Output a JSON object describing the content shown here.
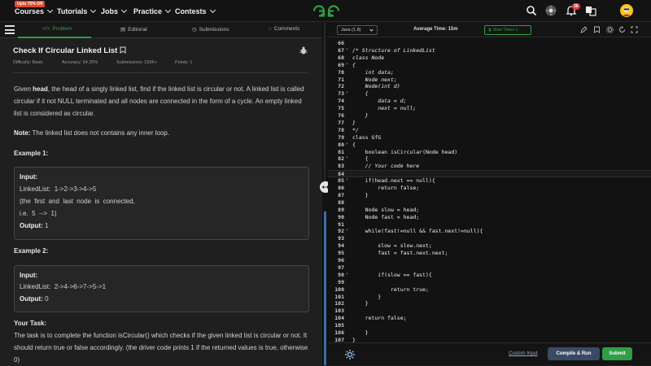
{
  "nav": {
    "promo": "Upto 75% Off",
    "items": [
      "Courses",
      "Tutorials",
      "Jobs",
      "Practice",
      "Contests"
    ],
    "notification_count": "38",
    "icons": [
      "search-icon",
      "theme-toggle-icon",
      "bell-icon",
      "translate-icon",
      "avatar"
    ]
  },
  "tabs": {
    "problem": "Problem",
    "editorial": "Editorial",
    "submissions": "Submissions",
    "comments": "Comments"
  },
  "problem": {
    "title": "Check If Circular Linked List",
    "difficulty": "Difficulty: Basic",
    "accuracy": "Accuracy: 54.26%",
    "submissions": "Submissions: 155K+",
    "points": "Points: 1",
    "desc_head": "head",
    "desc_pre": "Given ",
    "desc_post": ", the head of a singly linked list, find if the linked list is circular or not. A linked list is called circular if it not NULL terminated and all nodes are connected in the form of a cycle. An empty linked list is considered as circular.",
    "note_label": "Note:",
    "note_text": " The linked list does not contains any inner loop.",
    "example1_heading": "Example 1:",
    "example1": {
      "input_label": "Input:",
      "linked": "LinkedList:  1->2->3->4->5",
      "explain1": "(the  first  and  last  node  is  connected,",
      "explain2": "i.e.  5  -->  1)",
      "output_label": "Output:",
      "output": " 1"
    },
    "example2_heading": "Example 2:",
    "example2": {
      "input_label": "Input:",
      "linked": "LinkedList:  2->4->6->7->5->1",
      "output_label": "Output:",
      "output": " 0"
    },
    "task_heading": "Your Task:",
    "task_text": "The task is to complete the function isCircular() which checks if the given linked list is circular or not. It should return true or false accordingly. (the driver code prints 1 if the returned values is true, otherwise 0)"
  },
  "editor": {
    "language": "Java (1.8)",
    "avg_time": "Average Time: 15m",
    "start_timer": "Start Timer",
    "lines": [
      {
        "n": "66",
        "fold": "",
        "t": ""
      },
      {
        "n": "67",
        "fold": "▾",
        "t": "/* Structure of LinkedList"
      },
      {
        "n": "68",
        "fold": "",
        "t": "class Node"
      },
      {
        "n": "69",
        "fold": "▾",
        "t": "{"
      },
      {
        "n": "70",
        "fold": "",
        "t": "    int data;"
      },
      {
        "n": "71",
        "fold": "",
        "t": "    Node next;"
      },
      {
        "n": "72",
        "fold": "",
        "t": "    Node(int d)"
      },
      {
        "n": "73",
        "fold": "▾",
        "t": "    {"
      },
      {
        "n": "74",
        "fold": "",
        "t": "        data = d;"
      },
      {
        "n": "75",
        "fold": "",
        "t": "        next = null;"
      },
      {
        "n": "76",
        "fold": "",
        "t": "    }"
      },
      {
        "n": "77",
        "fold": "",
        "t": "}"
      },
      {
        "n": "78",
        "fold": "",
        "t": "*/"
      },
      {
        "n": "79",
        "fold": "",
        "t": "class GfG"
      },
      {
        "n": "80",
        "fold": "▾",
        "t": "{"
      },
      {
        "n": "81",
        "fold": "",
        "t": "    boolean isCircular(Node head)"
      },
      {
        "n": "82",
        "fold": "▾",
        "t": "    {"
      },
      {
        "n": "83",
        "fold": "",
        "t": "    // Your code here"
      },
      {
        "n": "84",
        "fold": "",
        "t": "    "
      },
      {
        "n": "85",
        "fold": "▾",
        "t": "    if(head.next == null){"
      },
      {
        "n": "86",
        "fold": "",
        "t": "        return false;"
      },
      {
        "n": "87",
        "fold": "",
        "t": "    }"
      },
      {
        "n": "88",
        "fold": "",
        "t": ""
      },
      {
        "n": "89",
        "fold": "",
        "t": "    Node slow = head;"
      },
      {
        "n": "90",
        "fold": "",
        "t": "    Node fast = head;"
      },
      {
        "n": "91",
        "fold": "",
        "t": ""
      },
      {
        "n": "92",
        "fold": "▾",
        "t": "    while(fast!=null && fast.next!=null){"
      },
      {
        "n": "93",
        "fold": "",
        "t": ""
      },
      {
        "n": "94",
        "fold": "",
        "t": "        slow = slow.next;"
      },
      {
        "n": "95",
        "fold": "",
        "t": "        fast = fast.next.next;"
      },
      {
        "n": "96",
        "fold": "",
        "t": ""
      },
      {
        "n": "97",
        "fold": "",
        "t": ""
      },
      {
        "n": "98",
        "fold": "▾",
        "t": "        if(slow == fast){"
      },
      {
        "n": "99",
        "fold": "",
        "t": ""
      },
      {
        "n": "100",
        "fold": "",
        "t": "            return true;"
      },
      {
        "n": "101",
        "fold": "",
        "t": "        }"
      },
      {
        "n": "102",
        "fold": "",
        "t": "    }"
      },
      {
        "n": "103",
        "fold": "",
        "t": ""
      },
      {
        "n": "104",
        "fold": "",
        "t": "    return false;"
      },
      {
        "n": "105",
        "fold": "",
        "t": ""
      },
      {
        "n": "106",
        "fold": "",
        "t": "    }"
      },
      {
        "n": "107",
        "fold": "",
        "t": "}"
      }
    ],
    "custom_input": "Custom Input",
    "compile_run": "Compile & Run",
    "submit": "Submit"
  },
  "colors": {
    "accent_green": "#2f9e44",
    "editor_bg": "#121212",
    "panel_bg": "#1f1f1f",
    "notification_red": "#e53935",
    "run_button": "#3b4a63"
  }
}
